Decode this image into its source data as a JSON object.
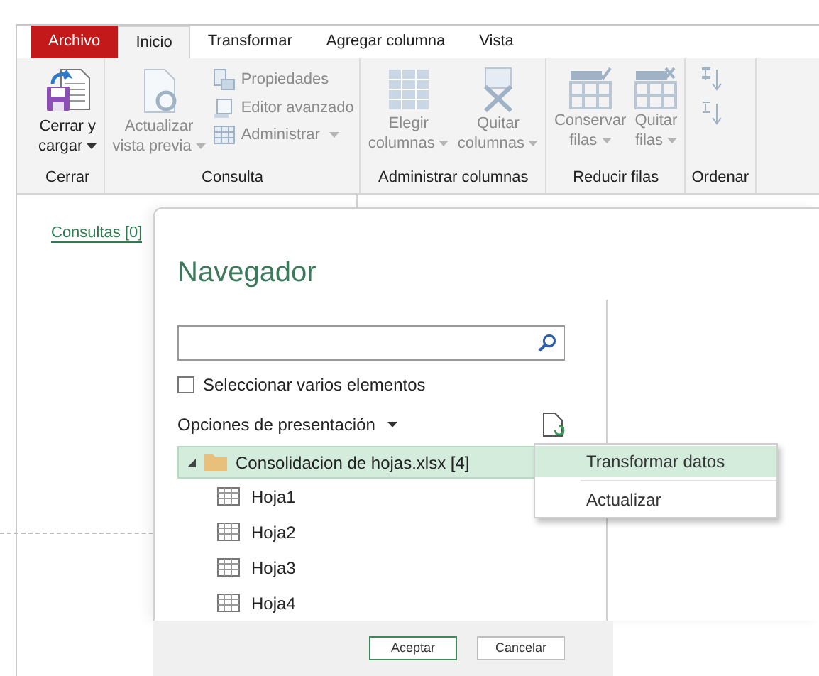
{
  "tabs": [
    {
      "label": "Archivo",
      "kind": "file",
      "selected": false
    },
    {
      "label": "Inicio",
      "kind": "tab",
      "selected": true
    },
    {
      "label": "Transformar",
      "kind": "tab",
      "selected": false
    },
    {
      "label": "Agregar columna",
      "kind": "tab",
      "selected": false
    },
    {
      "label": "Vista",
      "kind": "tab",
      "selected": false
    }
  ],
  "ribbon": [
    {
      "label": "Cerrar",
      "buttons": [
        {
          "lines": [
            "Cerrar y",
            "cargar"
          ],
          "kind": "large",
          "dropdown": true,
          "disabled": false
        }
      ]
    },
    {
      "label": "Consulta",
      "buttons": [
        {
          "lines": [
            "Actualizar",
            "vista previa"
          ],
          "kind": "large",
          "dropdown": true,
          "disabled": true
        },
        {
          "label": "Propiedades",
          "kind": "small",
          "dropdown": false,
          "disabled": true
        },
        {
          "label": "Editor avanzado",
          "kind": "small",
          "dropdown": false,
          "disabled": true
        },
        {
          "label": "Administrar",
          "kind": "small",
          "dropdown": true,
          "disabled": true
        }
      ]
    },
    {
      "label": "Administrar columnas",
      "buttons": [
        {
          "lines": [
            "Elegir",
            "columnas"
          ],
          "kind": "large",
          "dropdown": true,
          "disabled": true
        },
        {
          "lines": [
            "Quitar",
            "columnas"
          ],
          "kind": "large",
          "dropdown": true,
          "disabled": true
        }
      ]
    },
    {
      "label": "Reducir filas",
      "buttons": [
        {
          "lines": [
            "Conservar",
            "filas"
          ],
          "kind": "large",
          "dropdown": true,
          "disabled": true
        },
        {
          "lines": [
            "Quitar",
            "filas"
          ],
          "kind": "large",
          "dropdown": true,
          "disabled": true
        }
      ]
    },
    {
      "label": "Ordenar",
      "buttons": [
        {
          "kind": "sort",
          "disabled": true
        }
      ]
    }
  ],
  "queries_link": "Consultas [0]",
  "navigator": {
    "title": "Navegador",
    "multi_select": {
      "label": "Seleccionar varios elementos",
      "checked": false
    },
    "display_options": "Opciones de presentación",
    "tree": [
      {
        "label": "Consolidacion de hojas.xlsx [4]",
        "expanded": true,
        "selected": true,
        "children": [
          {
            "label": "Hoja1",
            "selected": false
          },
          {
            "label": "Hoja2",
            "selected": false
          },
          {
            "label": "Hoja3",
            "selected": false
          },
          {
            "label": "Hoja4",
            "selected": false
          }
        ]
      }
    ],
    "buttons": [
      {
        "label": "Aceptar",
        "kind": "default"
      },
      {
        "label": "Cancelar",
        "kind": "normal"
      }
    ]
  },
  "context_menu": [
    {
      "label": "Transformar datos",
      "selected": true
    },
    {
      "label": "Actualizar",
      "selected": false
    }
  ]
}
